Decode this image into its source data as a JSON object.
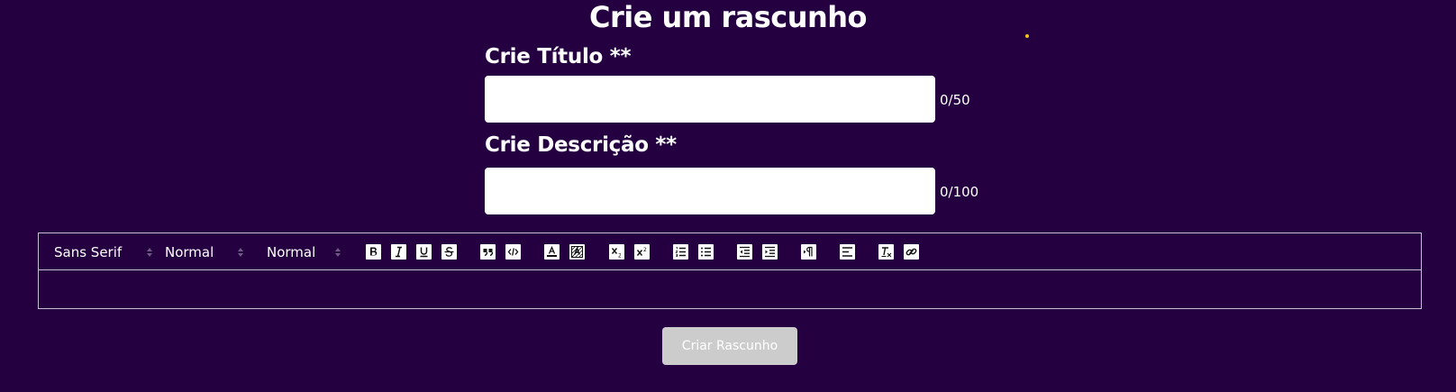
{
  "page": {
    "title": "Crie um rascunho"
  },
  "form": {
    "title_label": "Crie Título **",
    "title_value": "",
    "title_counter": "0/50",
    "description_label": "Crie Descrição **",
    "description_value": "",
    "description_counter": "0/100",
    "submit_label": "Criar Rascunho"
  },
  "editor": {
    "font_picker": "Sans Serif",
    "size_picker": "Normal",
    "header_picker": "Normal",
    "toolbar_buttons": [
      {
        "name": "bold-icon",
        "glyph": "B"
      },
      {
        "name": "italic-icon",
        "glyph": "I"
      },
      {
        "name": "underline-icon",
        "glyph": "U"
      },
      {
        "name": "strike-icon",
        "glyph": "S"
      },
      {
        "name": "blockquote-icon",
        "glyph": "99"
      },
      {
        "name": "code-block-icon",
        "glyph": "</>"
      },
      {
        "name": "text-color-icon",
        "glyph": "A"
      },
      {
        "name": "background-color-icon",
        "glyph": "A"
      },
      {
        "name": "subscript-icon",
        "glyph": "x2"
      },
      {
        "name": "superscript-icon",
        "glyph": "x2"
      },
      {
        "name": "ordered-list-icon",
        "glyph": "ol"
      },
      {
        "name": "bullet-list-icon",
        "glyph": "ul"
      },
      {
        "name": "outdent-icon",
        "glyph": "out"
      },
      {
        "name": "indent-icon",
        "glyph": "in"
      },
      {
        "name": "text-direction-icon",
        "glyph": "¶"
      },
      {
        "name": "align-icon",
        "glyph": "≡"
      },
      {
        "name": "clean-format-icon",
        "glyph": "Tx"
      },
      {
        "name": "link-icon",
        "glyph": "link"
      }
    ]
  },
  "colors": {
    "background": "#250041",
    "input_background": "#ffffff",
    "button_disabled": "#cccccc",
    "accent_dot": "#f5c518"
  }
}
